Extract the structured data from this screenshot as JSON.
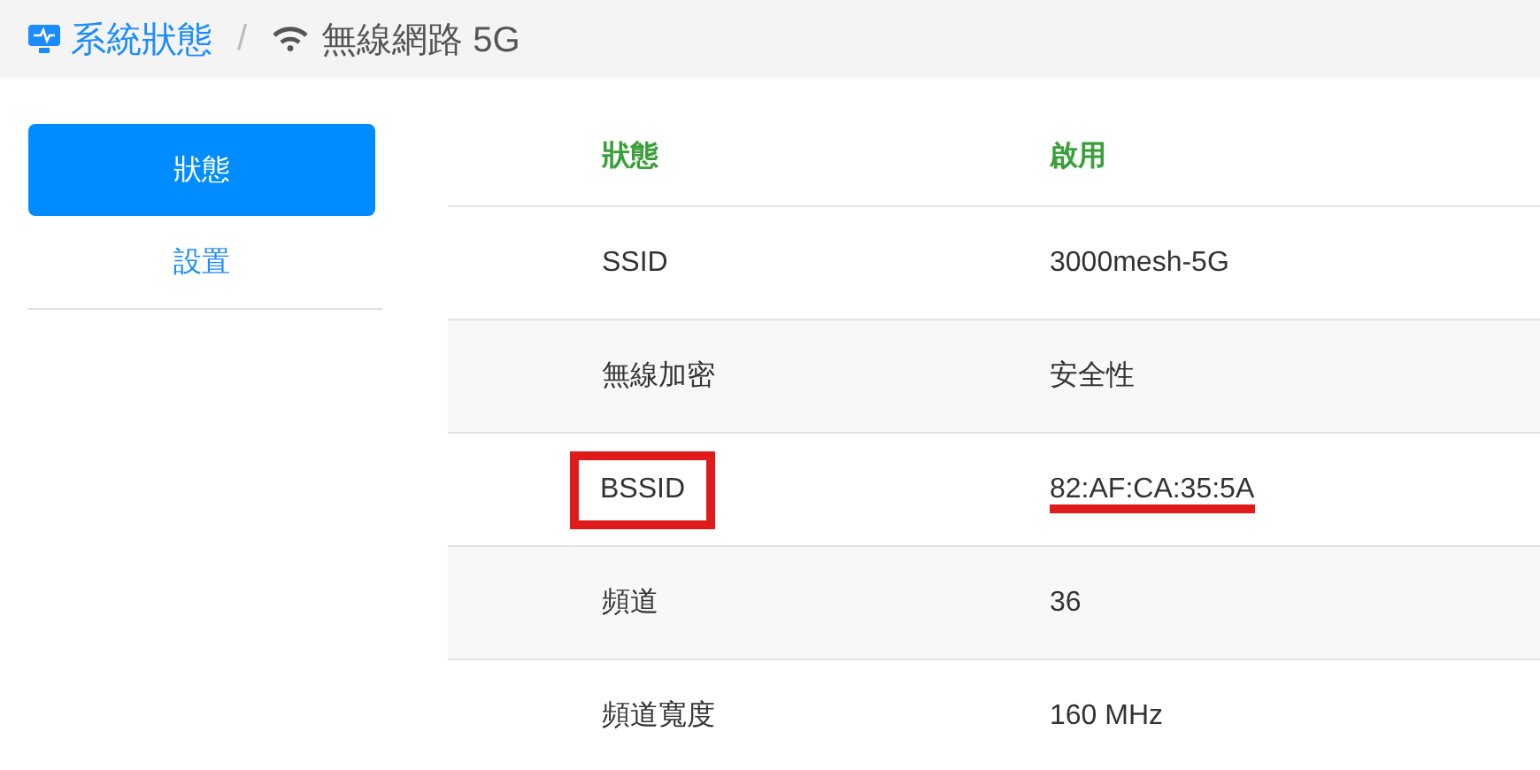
{
  "breadcrumb": {
    "root": "系統狀態",
    "separator": "/",
    "current": "無線網路 5G"
  },
  "sidebar": {
    "items": [
      {
        "label": "狀態",
        "selected": true
      },
      {
        "label": "設置",
        "selected": false
      }
    ]
  },
  "table": {
    "columns": [
      "狀態",
      "啟用"
    ],
    "rows": [
      {
        "label": "SSID",
        "value": "3000mesh-5G",
        "highlighted": false
      },
      {
        "label": "無線加密",
        "value": "安全性",
        "highlighted": false
      },
      {
        "label": "BSSID",
        "value": "82:AF:CA:35:5A",
        "highlighted": true
      },
      {
        "label": "頻道",
        "value": "36",
        "highlighted": false
      },
      {
        "label": "頻道寬度",
        "value": "160 MHz",
        "highlighted": false
      }
    ]
  }
}
